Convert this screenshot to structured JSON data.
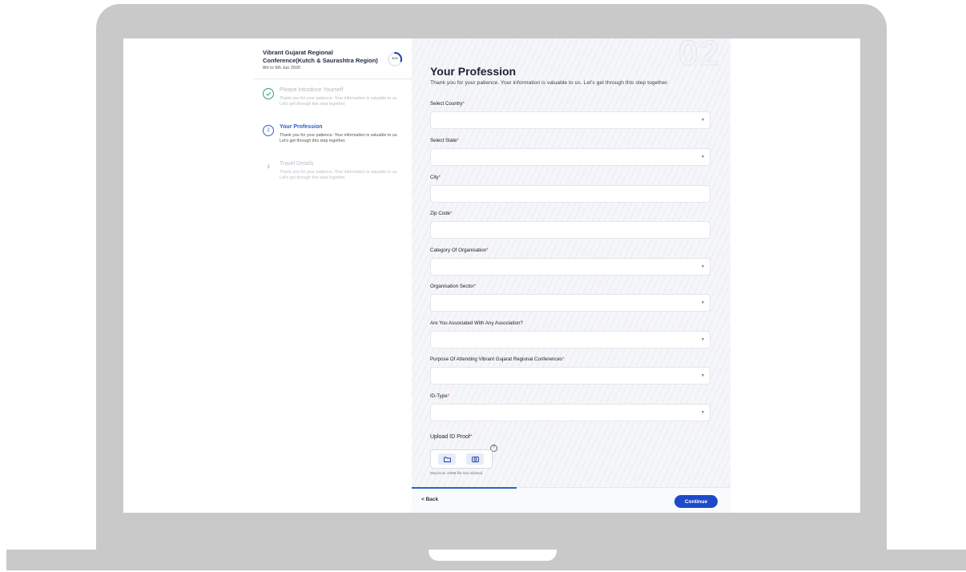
{
  "event": {
    "title": "Vibrant Gujarat Regional Conference(Kutch & Saurashtra Region)",
    "date": "8th to 9th Jun 2026",
    "progress_percent": 30,
    "progress_label": "30%"
  },
  "steps": [
    {
      "number": "1",
      "title": "Please Introduce Yourself",
      "description": "Thank you for your patience. Your information is valuable to us. Let's get through this step together.",
      "state": "done"
    },
    {
      "number": "2",
      "title": "Your Profession",
      "description": "Thank you for your patience. Your information is valuable to us. Let's get through this step together.",
      "state": "active"
    },
    {
      "number": "3",
      "title": "Travel Details",
      "description": "Thank you for your patience. Your information is valuable to us. Let's get through this step together.",
      "state": "todo"
    }
  ],
  "form": {
    "background_number": "02",
    "title": "Your Profession",
    "subtitle": "Thank you for your patience. Your information is valuable to us. Let's get through this step together.",
    "fields": [
      {
        "label": "Select Country",
        "required": "*",
        "type": "select"
      },
      {
        "label": "Select State",
        "required": "*",
        "type": "select"
      },
      {
        "label": "City",
        "required": "*",
        "type": "text"
      },
      {
        "label": "Zip Code",
        "required": "*",
        "type": "text"
      },
      {
        "label": "Category Of Organisation",
        "required": "*",
        "type": "select"
      },
      {
        "label": "Organisation Sector",
        "required": "*",
        "type": "select"
      },
      {
        "label": "Are You Associated With Any Association?",
        "required": "",
        "type": "select"
      },
      {
        "label": "Purpose Of Attending Vibrant Gujarat Regional Conferences",
        "required": "*",
        "type": "select"
      },
      {
        "label": "ID-Type",
        "required": "*",
        "type": "select"
      }
    ],
    "upload": {
      "label": "Upload ID Proof",
      "required": "*",
      "help": "?",
      "hint": "Maximum 10MB file size allowed"
    }
  },
  "footer": {
    "back_label": "Back",
    "back_icon": "<",
    "continue_label": "Continue"
  },
  "colors": {
    "accent": "#2d62c9",
    "button": "#1f49c9",
    "done": "#2e9d77",
    "required": "#e03a3a"
  }
}
